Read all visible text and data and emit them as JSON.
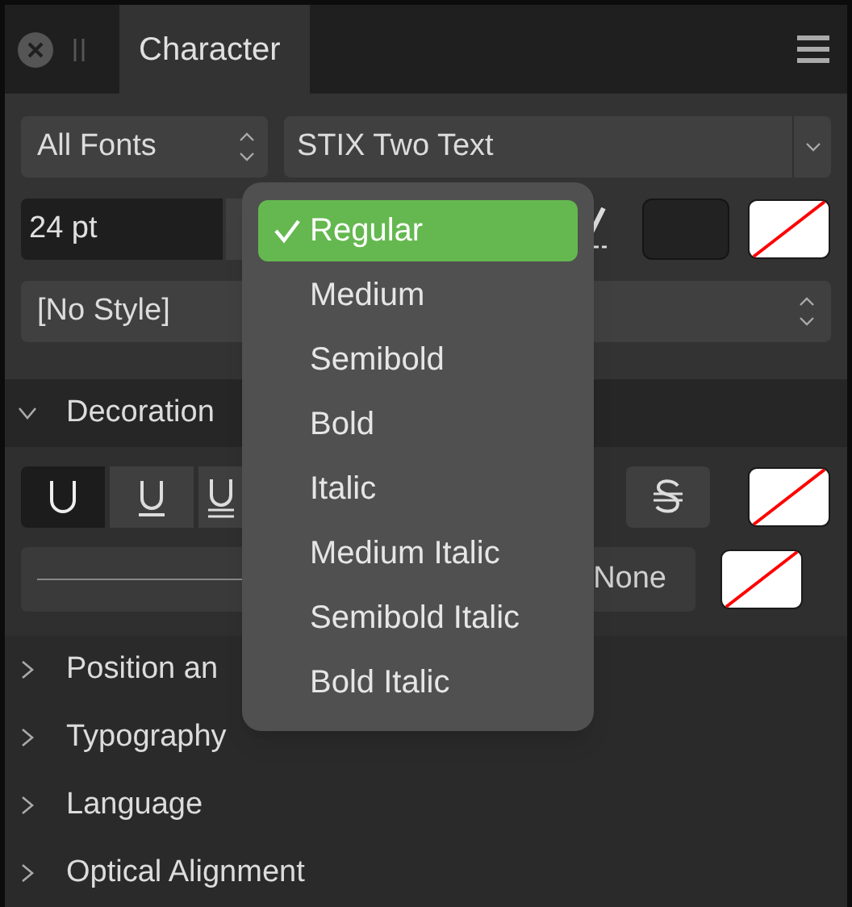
{
  "panel": {
    "tabs": [
      {
        "label": "Character",
        "selected": true
      }
    ]
  },
  "font_collection": {
    "value": "All Fonts"
  },
  "font_family": {
    "value": "STIX Two Text"
  },
  "font_size": {
    "value": "24 pt"
  },
  "paragraph_style": {
    "value": "[No Style]"
  },
  "sections": [
    {
      "title": "Decoration",
      "expanded": true
    },
    {
      "title": "Position an",
      "expanded": false
    },
    {
      "title": "Typography",
      "expanded": false
    },
    {
      "title": "Language",
      "expanded": false
    },
    {
      "title": "Optical Alignment",
      "expanded": false
    }
  ],
  "decoration_buttons": [
    {
      "kind": "none",
      "selected": true
    },
    {
      "kind": "underline",
      "selected": false
    },
    {
      "kind": "double",
      "selected": false
    },
    {
      "kind": "strike",
      "selected": false
    }
  ],
  "line_style": {
    "value": "None"
  },
  "style_menu": {
    "items": [
      {
        "label": "Regular",
        "selected": true
      },
      {
        "label": "Medium",
        "selected": false
      },
      {
        "label": "Semibold",
        "selected": false
      },
      {
        "label": "Bold",
        "selected": false
      },
      {
        "label": "Italic",
        "selected": false
      },
      {
        "label": "Medium Italic",
        "selected": false
      },
      {
        "label": "Semibold Italic",
        "selected": false
      },
      {
        "label": "Bold Italic",
        "selected": false
      }
    ]
  }
}
